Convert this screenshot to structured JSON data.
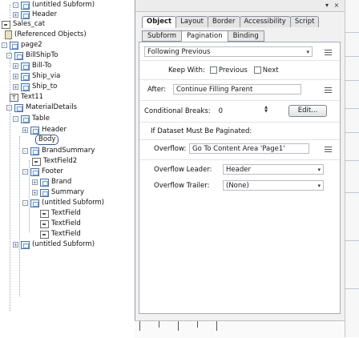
{
  "hierarchy": {
    "nodes": [
      {
        "label": "(untitled Subform)",
        "icon": "subform-icon",
        "expander": "-"
      },
      {
        "label": "Header",
        "icon": "subform-icon",
        "expander": "+"
      },
      {
        "label": "Sales_cat",
        "icon": "field-icon",
        "expander": ""
      },
      {
        "label": "(Referenced Objects)",
        "icon": "referenced-objects-icon",
        "expander": ""
      },
      {
        "label": "page2",
        "icon": "subform-icon",
        "expander": "-"
      },
      {
        "label": "BillShipTo",
        "icon": "subform-icon",
        "expander": "-"
      },
      {
        "label": "Bill-To",
        "icon": "subform-icon",
        "expander": "+"
      },
      {
        "label": "Ship_via",
        "icon": "subform-icon",
        "expander": "+"
      },
      {
        "label": "Ship_to",
        "icon": "subform-icon",
        "expander": "+"
      },
      {
        "label": "Text11",
        "icon": "text-icon",
        "expander": ""
      },
      {
        "label": "MaterialDetails",
        "icon": "subform-icon",
        "expander": "-"
      },
      {
        "label": "Table",
        "icon": "subform-icon",
        "expander": "-"
      },
      {
        "label": "Header",
        "icon": "subform-icon",
        "expander": "+"
      },
      {
        "label": "Body",
        "icon": "subform-icon",
        "expander": ""
      },
      {
        "label": "BrandSummary",
        "icon": "subform-icon",
        "expander": "-"
      },
      {
        "label": "TextField2",
        "icon": "field-icon",
        "expander": ""
      },
      {
        "label": "Footer",
        "icon": "subform-icon",
        "expander": "-"
      },
      {
        "label": "Brand",
        "icon": "subform-icon",
        "expander": "+"
      },
      {
        "label": "Summary",
        "icon": "subform-icon",
        "expander": "+"
      },
      {
        "label": "(untitled Subform)",
        "icon": "subform-icon",
        "expander": "-"
      },
      {
        "label": "TextField",
        "icon": "field-icon",
        "expander": ""
      },
      {
        "label": "TextField",
        "icon": "field-icon",
        "expander": ""
      },
      {
        "label": "TextField",
        "icon": "field-icon",
        "expander": ""
      },
      {
        "label": "(untitled Subform)",
        "icon": "subform-icon",
        "expander": "+"
      }
    ]
  },
  "palette": {
    "close_glyph": "×",
    "menu_glyph": "▾",
    "tabs": [
      {
        "label": "Object",
        "active": true
      },
      {
        "label": "Layout",
        "active": false
      },
      {
        "label": "Border",
        "active": false
      },
      {
        "label": "Accessibility",
        "active": false
      },
      {
        "label": "Script",
        "active": false
      }
    ],
    "subtabs": [
      {
        "label": "Subform",
        "active": false
      },
      {
        "label": "Pagination",
        "active": true
      },
      {
        "label": "Binding",
        "active": false
      }
    ],
    "placement": {
      "value": "Following Previous"
    },
    "keep_with": {
      "label": "Keep With:",
      "previous": "Previous",
      "next": "Next"
    },
    "after": {
      "label": "After:",
      "value": "Continue Filling Parent"
    },
    "conditional_breaks": {
      "label": "Conditional Breaks:",
      "count": "0",
      "button": "Edit..."
    },
    "paginated": {
      "label": "If Dataset Must Be Paginated:"
    },
    "overflow": {
      "label": "Overflow:",
      "value": "Go To Content Area 'Page1'"
    },
    "overflow_leader": {
      "label": "Overflow Leader:",
      "value": "Header"
    },
    "overflow_trailer": {
      "label": "Overflow Trailer:",
      "value": "(None)"
    }
  },
  "colors": {
    "accent": "#3c5a8a",
    "panel_bg": "#f1f1f1",
    "border": "#9aa0a8"
  }
}
